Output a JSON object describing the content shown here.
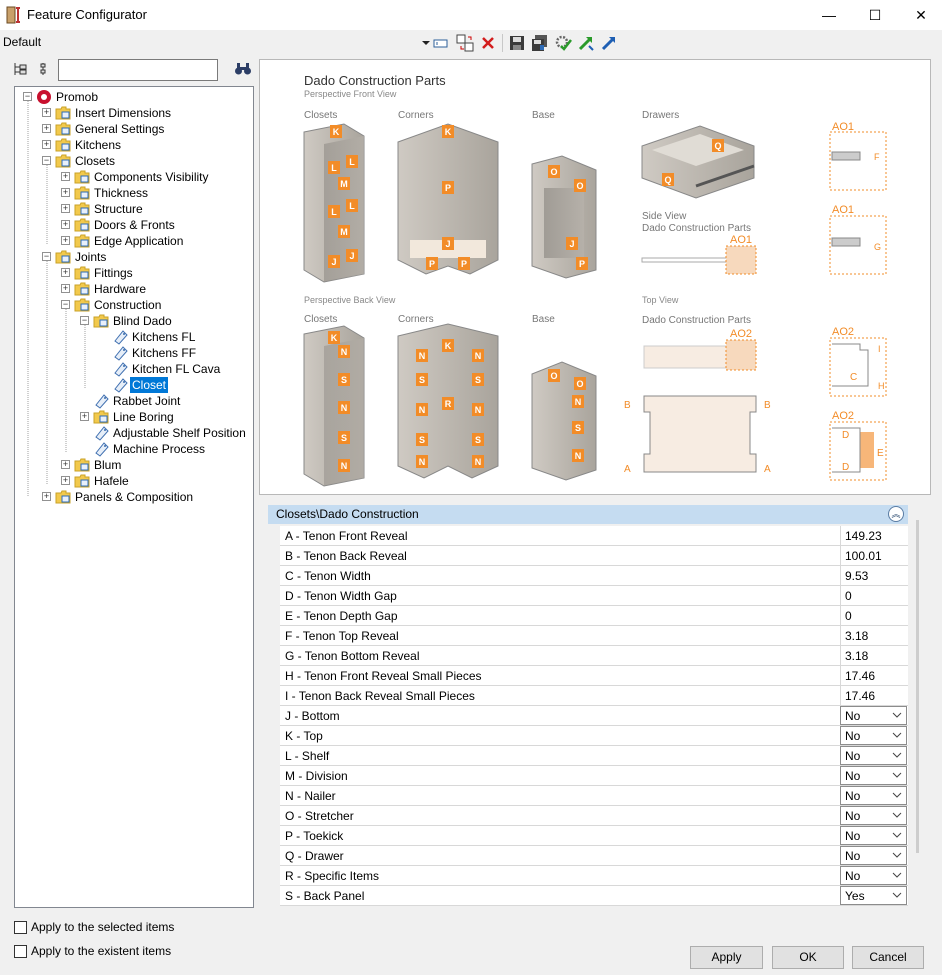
{
  "window": {
    "title": "Feature Configurator",
    "minimize_glyph": "—",
    "maximize_glyph": "☐",
    "close_glyph": "✕"
  },
  "toolbar": {
    "profile": "Default",
    "icons": [
      "dropdown-arrow-icon",
      "edit-field-icon",
      "transfer-icon",
      "delete-icon",
      "save-icon",
      "save-all-icon",
      "settings-check-icon",
      "import-icon",
      "export-icon"
    ]
  },
  "tree": {
    "items": [
      {
        "label": "Promob",
        "level": 0,
        "type": "root"
      },
      {
        "label": "Insert Dimensions",
        "level": 1,
        "type": "folder"
      },
      {
        "label": "General Settings",
        "level": 1,
        "type": "folder"
      },
      {
        "label": "Kitchens",
        "level": 1,
        "type": "folder"
      },
      {
        "label": "Closets",
        "level": 1,
        "type": "folder"
      },
      {
        "label": "Components Visibility",
        "level": 2,
        "type": "folder"
      },
      {
        "label": "Thickness",
        "level": 2,
        "type": "folder"
      },
      {
        "label": "Structure",
        "level": 2,
        "type": "folder"
      },
      {
        "label": "Doors & Fronts",
        "level": 2,
        "type": "folder"
      },
      {
        "label": "Edge Application",
        "level": 2,
        "type": "folder"
      },
      {
        "label": "Joints",
        "level": 1,
        "type": "folder"
      },
      {
        "label": "Fittings",
        "level": 2,
        "type": "folder"
      },
      {
        "label": "Hardware",
        "level": 2,
        "type": "folder"
      },
      {
        "label": "Construction",
        "level": 2,
        "type": "folder"
      },
      {
        "label": "Blind Dado",
        "level": 3,
        "type": "folder"
      },
      {
        "label": "Kitchens FL",
        "level": 4,
        "type": "leaf"
      },
      {
        "label": "Kitchens FF",
        "level": 4,
        "type": "leaf"
      },
      {
        "label": "Kitchen FL Cava",
        "level": 4,
        "type": "leaf"
      },
      {
        "label": "Closet",
        "level": 4,
        "type": "leaf",
        "selected": true
      },
      {
        "label": "Rabbet Joint",
        "level": 3,
        "type": "leaf"
      },
      {
        "label": "Line Boring",
        "level": 3,
        "type": "folder"
      },
      {
        "label": "Adjustable Shelf Position",
        "level": 3,
        "type": "leaf"
      },
      {
        "label": "Machine Process",
        "level": 3,
        "type": "leaf"
      },
      {
        "label": "Blum",
        "level": 2,
        "type": "folder"
      },
      {
        "label": "Hafele",
        "level": 2,
        "type": "folder"
      },
      {
        "label": "Panels & Composition",
        "level": 1,
        "type": "folder"
      }
    ]
  },
  "diagram": {
    "title": "Dado Construction Parts",
    "subtitle_front": "Perspective Front View",
    "subtitle_back": "Perspective Back View",
    "col_closets": "Closets",
    "col_corners": "Corners",
    "col_base": "Base",
    "col_drawers": "Drawers",
    "side_view": "Side View",
    "side_view_sub": "Dado Construction Parts",
    "top_view": "Top View",
    "top_view_sub": "Dado Construction Parts",
    "ao1": "AO1",
    "ao2": "AO2",
    "accent": "#f28c28"
  },
  "grid": {
    "header": "Closets\\Dado Construction",
    "rows": [
      {
        "name": "A - Tenon Front Reveal",
        "value": "149.23",
        "kind": "text"
      },
      {
        "name": "B - Tenon Back Reveal",
        "value": "100.01",
        "kind": "text"
      },
      {
        "name": "C - Tenon Width",
        "value": "9.53",
        "kind": "text"
      },
      {
        "name": "D - Tenon Width Gap",
        "value": "0",
        "kind": "text"
      },
      {
        "name": "E - Tenon Depth Gap",
        "value": "0",
        "kind": "text"
      },
      {
        "name": "F - Tenon Top Reveal",
        "value": "3.18",
        "kind": "text"
      },
      {
        "name": "G - Tenon Bottom Reveal",
        "value": "3.18",
        "kind": "text"
      },
      {
        "name": "H - Tenon Front Reveal Small Pieces",
        "value": "17.46",
        "kind": "text"
      },
      {
        "name": "I - Tenon Back Reveal Small Pieces",
        "value": "17.46",
        "kind": "text"
      },
      {
        "name": "J -  Bottom",
        "value": "No",
        "kind": "select"
      },
      {
        "name": "K -  Top",
        "value": "No",
        "kind": "select"
      },
      {
        "name": "L -  Shelf",
        "value": "No",
        "kind": "select"
      },
      {
        "name": "M -  Division",
        "value": "No",
        "kind": "select"
      },
      {
        "name": "N -  Nailer",
        "value": "No",
        "kind": "select"
      },
      {
        "name": "O - Stretcher",
        "value": "No",
        "kind": "select"
      },
      {
        "name": "P -  Toekick",
        "value": "No",
        "kind": "select"
      },
      {
        "name": "Q -  Drawer",
        "value": "No",
        "kind": "select"
      },
      {
        "name": "R -  Specific Items",
        "value": "No",
        "kind": "select"
      },
      {
        "name": "S - Back Panel",
        "value": "Yes",
        "kind": "select"
      }
    ]
  },
  "footer": {
    "apply_selected": "Apply to the selected items",
    "apply_existent": "Apply to the existent items",
    "apply": "Apply",
    "ok": "OK",
    "cancel": "Cancel"
  }
}
